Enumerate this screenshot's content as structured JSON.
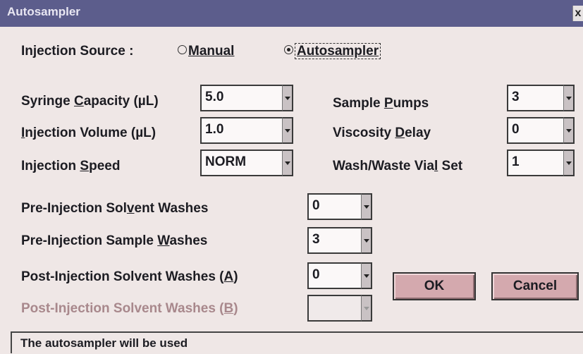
{
  "window": {
    "title": "Autosampler",
    "close": "x"
  },
  "injection_source": {
    "label": "Injection Source :",
    "manual": "Manual",
    "autosampler": "Autosampler",
    "selected": "autosampler"
  },
  "fields": {
    "syringe_capacity": {
      "label_pre": "Syringe ",
      "label_key": "C",
      "label_post": "apacity (µL)",
      "value": "5.0"
    },
    "injection_volume": {
      "label_key": "I",
      "label_post": "njection Volume (µL)",
      "value": "1.0"
    },
    "injection_speed": {
      "label_pre": "Injection ",
      "label_key": "S",
      "label_post": "peed",
      "value": "NORM"
    },
    "sample_pumps": {
      "label_pre": "Sample ",
      "label_key": "P",
      "label_post": "umps",
      "value": "3"
    },
    "viscosity_delay": {
      "label_pre": "Viscosity ",
      "label_key": "D",
      "label_post": "elay",
      "value": "0"
    },
    "wash_waste_vial_set": {
      "label_pre": "Wash/Waste Via",
      "label_key": "l",
      "label_post": " Set",
      "value": "1"
    },
    "pre_injection_solvent_washes": {
      "label_pre": "Pre-Injection Sol",
      "label_key": "v",
      "label_post": "ent Washes",
      "value": "0"
    },
    "pre_injection_sample_washes": {
      "label_pre": "Pre-Injection Sample ",
      "label_key": "W",
      "label_post": "ashes",
      "value": "3"
    },
    "post_injection_solvent_washes_a": {
      "label_pre": "Post-Injection Solvent Washes (",
      "label_key": "A",
      "label_post": ")",
      "value": "0"
    },
    "post_injection_solvent_washes_b": {
      "label_pre": "Post-Injection Solvent Washes (",
      "label_key": "B",
      "label_post": ")",
      "value": ""
    }
  },
  "buttons": {
    "ok": "OK",
    "cancel": "Cancel"
  },
  "status": "The autosampler will be used"
}
